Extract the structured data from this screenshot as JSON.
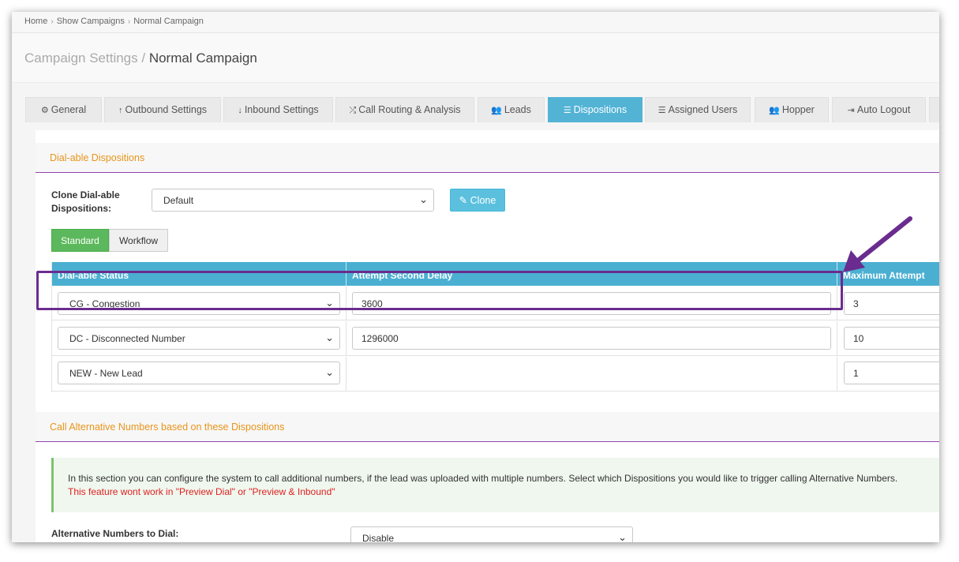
{
  "breadcrumb": {
    "home": "Home",
    "show_campaigns": "Show Campaigns",
    "current": "Normal Campaign",
    "separator": "›"
  },
  "header": {
    "title_prefix": "Campaign Settings /",
    "title_main": "Normal Campaign"
  },
  "tabs": [
    {
      "label": "General",
      "icon": "cogs-icon",
      "glyph": "⚙",
      "active": false
    },
    {
      "label": "Outbound Settings",
      "icon": "arrow-up-icon",
      "glyph": "↑",
      "active": false
    },
    {
      "label": "Inbound Settings",
      "icon": "arrow-down-icon",
      "glyph": "↓",
      "active": false
    },
    {
      "label": "Call Routing & Analysis",
      "icon": "random-icon",
      "glyph": "⤮",
      "active": false
    },
    {
      "label": "Leads",
      "icon": "users-icon",
      "glyph": "👥",
      "active": false
    },
    {
      "label": "Dispositions",
      "icon": "list-icon",
      "glyph": "☰",
      "active": true
    },
    {
      "label": "Assigned Users",
      "icon": "list-ol-icon",
      "glyph": "☰",
      "active": false
    },
    {
      "label": "Hopper",
      "icon": "users-icon",
      "glyph": "👥",
      "active": false
    },
    {
      "label": "Auto Logout",
      "icon": "sign-out-icon",
      "glyph": "⇥",
      "active": false
    }
  ],
  "dialable": {
    "heading": "Dial-able Dispositions",
    "clone_label": "Clone Dial-able Dispositions:",
    "clone_select": "Default",
    "clone_button": "Clone",
    "clone_icon": "edit-icon",
    "standard_button": "Standard",
    "workflow_button": "Workflow",
    "table": {
      "headers": [
        "Dial-able Status",
        "Attempt Second Delay",
        "Maximum Attempt"
      ],
      "rows": [
        {
          "status": "CG - Congestion",
          "delay": "3600",
          "max": "3"
        },
        {
          "status": "DC - Disconnected Number",
          "delay": "1296000",
          "max": "10"
        },
        {
          "status": "NEW - New Lead",
          "delay": "",
          "max": "1"
        }
      ]
    }
  },
  "alt_numbers": {
    "heading": "Call Alternative Numbers based on these Dispositions",
    "info_line1": "In this section you can configure the system to call additional numbers, if the lead was uploaded with multiple numbers. Select which Dispositions you would like to trigger calling Alternative Numbers.",
    "info_line2": "This feature wont work in \"Preview Dial\" or \"Preview & Inbound\"",
    "dial_label": "Alternative Numbers to Dial:",
    "dial_select": "Disable"
  },
  "annotation": {
    "color": "#6a2c8e"
  },
  "colors": {
    "accent": "#53b3d5",
    "table_header": "#4bafd2",
    "success": "#5cb85c",
    "heading": "#e8951b",
    "danger": "#e02020"
  }
}
